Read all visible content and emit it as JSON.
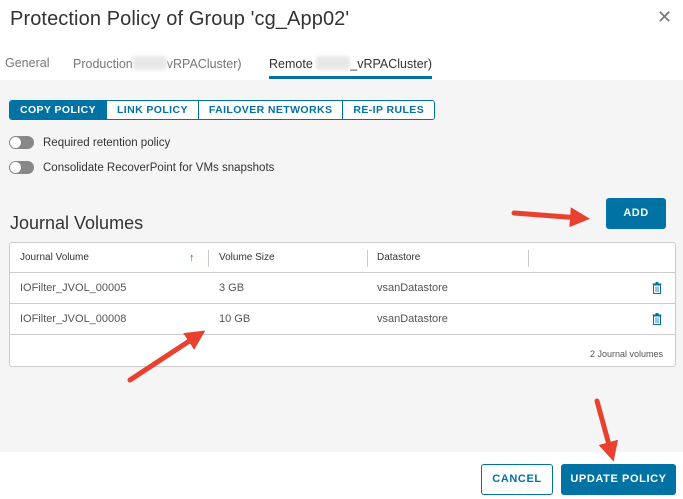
{
  "dialog": {
    "title": "Protection Policy of Group 'cg_App02'",
    "close_symbol": "✕"
  },
  "tabs": [
    {
      "label": "General"
    },
    {
      "label_prefix": "Production",
      "label_suffix": "vRPACluster)"
    },
    {
      "label_prefix": "Remote",
      "label_suffix": "_vRPACluster)"
    }
  ],
  "policy_tabs": [
    "COPY POLICY",
    "LINK POLICY",
    "FAILOVER NETWORKS",
    "RE-IP RULES"
  ],
  "toggles": [
    {
      "label": "Required retention policy"
    },
    {
      "label": "Consolidate RecoverPoint for VMs snapshots"
    }
  ],
  "journal": {
    "title": "Journal Volumes",
    "add_label": "ADD",
    "columns": [
      "Journal Volume",
      "Volume Size",
      "Datastore"
    ],
    "rows": [
      {
        "name": "IOFilter_JVOL_00005",
        "size": "3 GB",
        "datastore": "vsanDatastore"
      },
      {
        "name": "IOFilter_JVOL_00008",
        "size": "10 GB",
        "datastore": "vsanDatastore"
      }
    ],
    "footer": "2 Journal volumes"
  },
  "footer": {
    "cancel_label": "CANCEL",
    "update_label": "UPDATE POLICY"
  },
  "colors": {
    "accent": "#0072a3",
    "annotation_arrow": "#e8412f"
  },
  "icons": {
    "sort": "arrow-up-icon",
    "delete": "trash-icon",
    "close": "close-icon"
  }
}
